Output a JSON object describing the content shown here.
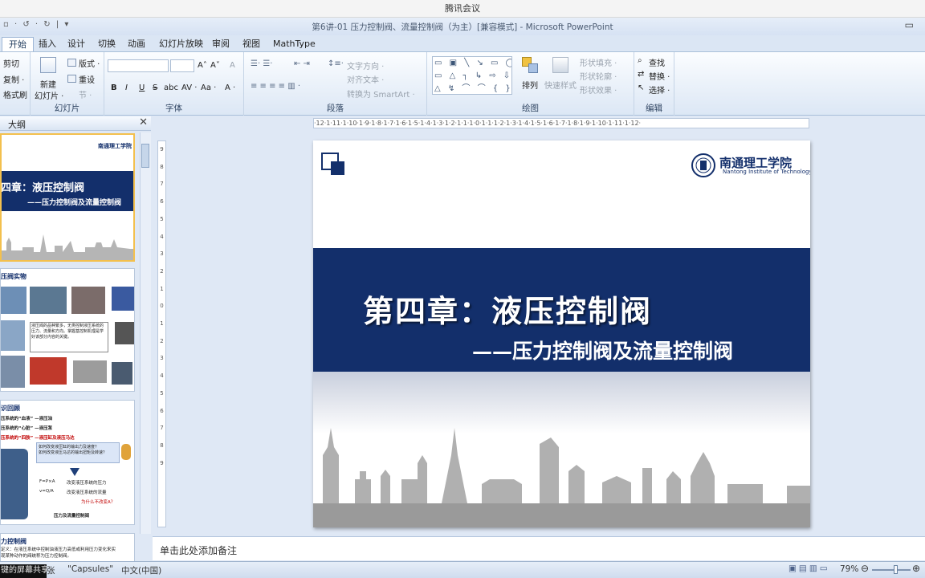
{
  "meeting": {
    "title": "腾讯会议"
  },
  "window": {
    "title": "第6讲-01 压力控制阀、流量控制阀（为主）[兼容模式] - Microsoft PowerPoint",
    "qat": "▫ · ↺ · ↻ | ▾"
  },
  "tabs": [
    "开始",
    "插入",
    "设计",
    "切换",
    "动画",
    "幻灯片放映",
    "审阅",
    "视图",
    "MathType"
  ],
  "ribbon": {
    "clipboard": {
      "cut": "剪切",
      "copy": "复制 ·",
      "format_painter": "格式刷",
      "label": ""
    },
    "slides": {
      "new_slide_line1": "新建",
      "new_slide_line2": "幻灯片 ·",
      "layout": "版式 ·",
      "reset": "重设",
      "section": "节 ·",
      "label": "幻灯片"
    },
    "font": {
      "bold": "B",
      "italic": "I",
      "underline": "U",
      "strike": "S",
      "shadow": "abc",
      "spacing": "AV ·",
      "case": "Aa ·",
      "color": "A ·",
      "grow": "A˄",
      "shrink": "A˅",
      "clear": "A",
      "label": "字体"
    },
    "paragraph": {
      "text_direction": "文字方向 ·",
      "align_text": "对齐文本 ·",
      "smartart": "转换为 SmartArt ·",
      "label": "段落"
    },
    "drawing": {
      "shapes": "▭ ▣ ╲ ↘ ▭ ◯\n▭ △ ┐ ↳ ⇨ ⇩\n△ ↯ ⌒ ⌒ { }",
      "arrange": "排列",
      "quick_styles": "快速样式",
      "fill": "形状填充 ·",
      "outline": "形状轮廓 ·",
      "effects": "形状效果 ·",
      "label": "绘图"
    },
    "editing": {
      "find": "查找",
      "replace": "替换 ·",
      "select": "选择 ·",
      "label": "编辑"
    }
  },
  "panel": {
    "tab_label": "大纲",
    "close": "✕"
  },
  "thumbs": [
    {
      "title": "第四章：液压控制阀",
      "subtitle": "——压力控制阀及流量控制阀",
      "logo": "南通理工学院"
    },
    {
      "heading": "压阀实物",
      "text": "液压阀的品种繁多，无类控制液压系统的压力、流量和方向。掌握基控制机理是学好该部分内容的关键。"
    },
    {
      "heading": "识回顾",
      "lines": [
        "压系统的“血液” —液压油",
        "压系统的“心脏” —液压泵",
        "压系统的“四肢” —液压缸及液压马达"
      ],
      "q1": "如何改变液压缸的输出力及速度？",
      "q2": "如何改变液压马达的输出扭矩及转速？",
      "f1": "F=P×A",
      "f1t": "改变液压系统的压力",
      "f2": "v=Q/A",
      "f2t": "改变液压系统的流量",
      "q3": "为什么不改变A？",
      "bottom": "压力及流量控制阀"
    },
    {
      "heading": "力控制阀",
      "text": "定义：在液压系统中控制油液压力高低或利用压力变化来实现某种动作的阀统称为压力控制阀。"
    }
  ],
  "slide": {
    "logo_cn": "南通理工学院",
    "logo_en": "Nantong Institute of Technology",
    "title": "第四章：液压控制阀",
    "subtitle": "——压力控制阀及流量控制阀"
  },
  "rulers": {
    "top": "·12·1·11·1·10·1·9·1·8·1·7·1·6·1·5·1·4·1·3·1·2·1·1·1·0·1·1·1·2·1·3·1·4·1·5·1·6·1·7·1·8·1·9·1·10·1·11·1·12·",
    "left": [
      "9",
      "8",
      "7",
      "6",
      "5",
      "4",
      "3",
      "2",
      "1",
      "0",
      "1",
      "2",
      "3",
      "4",
      "5",
      "6",
      "7",
      "8",
      "9"
    ]
  },
  "notes": {
    "placeholder": "单击此处添加备注"
  },
  "status": {
    "theme": "\"Capsules\"",
    "language": "中文(中国)",
    "zoom": "79%",
    "screen_share": "键的屏幕共享",
    "slide_label": "张"
  },
  "colors": {
    "slide_band": "#132f6b",
    "ribbon_bg": "#dce7f5",
    "accent_selected": "#f3c04e"
  }
}
